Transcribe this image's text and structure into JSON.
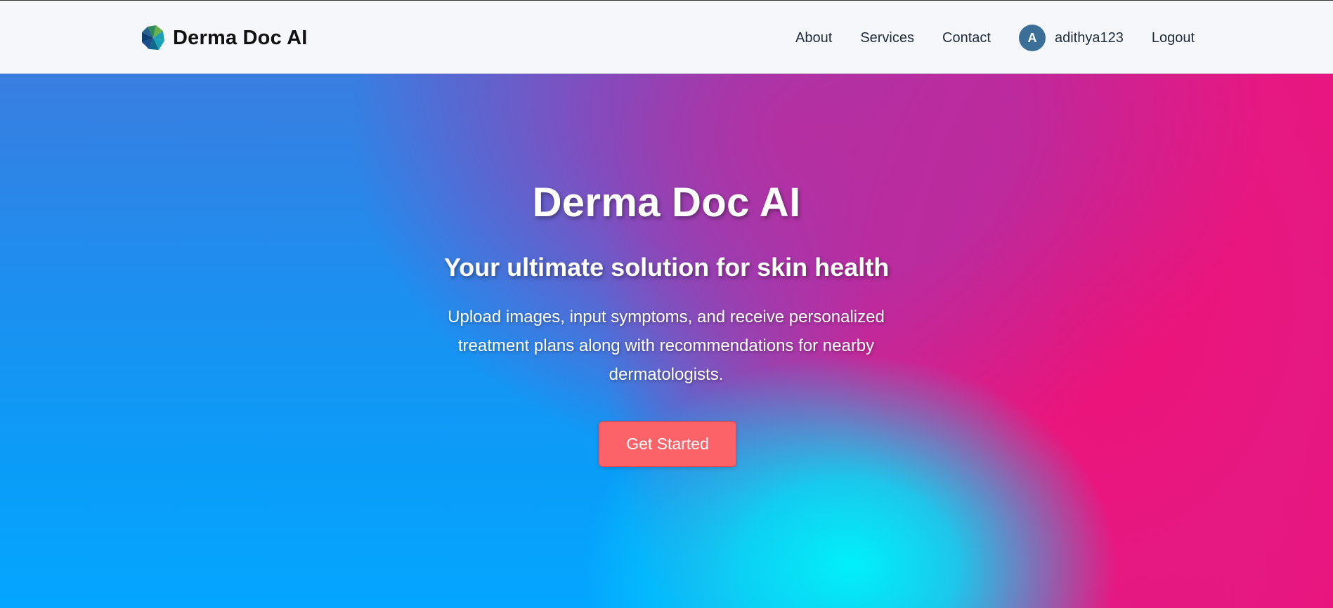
{
  "brand": {
    "name": "Derma Doc AI",
    "logo_icon": "aperture-logo-icon"
  },
  "nav": {
    "links": [
      {
        "label": "About"
      },
      {
        "label": "Services"
      },
      {
        "label": "Contact"
      }
    ],
    "user": {
      "avatar_initial": "A",
      "username": "adithya123"
    },
    "logout_label": "Logout"
  },
  "hero": {
    "title": "Derma Doc AI",
    "subtitle": "Your ultimate solution for skin health",
    "description": "Upload images, input symptoms, and receive personalized treatment plans along with recommendations for nearby dermatologists.",
    "cta_label": "Get Started"
  },
  "colors": {
    "cta": "#fb6369",
    "avatar": "#3b6f98",
    "navbar_bg": "#f6f7fb",
    "gradient_blue": "#0aa0ff",
    "gradient_pink": "#ee1276",
    "gradient_cyan": "#00f0fa",
    "gradient_purple": "#b62ea0"
  }
}
